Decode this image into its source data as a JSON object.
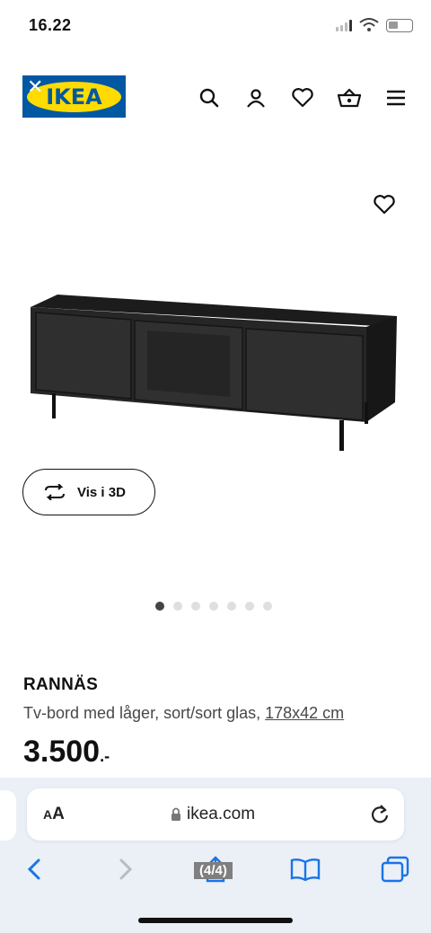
{
  "status": {
    "time": "16.22"
  },
  "header": {
    "logo_text": "IKEA",
    "icons": [
      "search-icon",
      "user-icon",
      "heart-icon",
      "basket-icon",
      "menu-icon"
    ]
  },
  "gallery": {
    "view_3d_label": "Vis i 3D",
    "dots_count": 7,
    "active_dot": 0
  },
  "product": {
    "name": "RANNÄS",
    "description": "Tv-bord med låger, sort/sort glas,",
    "dimensions": "178x42 cm",
    "price": "3.500",
    "price_suffix": ".-"
  },
  "browser": {
    "aa_label_small": "A",
    "aa_label_large": "A",
    "url": "ikea.com",
    "page_counter": "(4/4)"
  },
  "colors": {
    "ikea_blue": "#0058a3",
    "ikea_yellow": "#ffdb00",
    "browser_accent": "#1a73e8"
  }
}
